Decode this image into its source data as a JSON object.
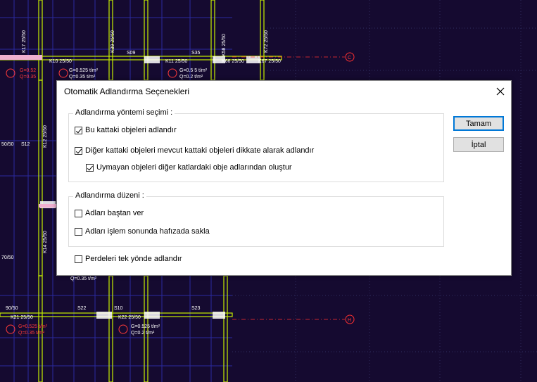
{
  "dialog": {
    "title": "Otomatik Adlandırma Seçenekleri",
    "method_group": {
      "label": "Adlandırma yöntemi seçimi :",
      "options": [
        {
          "label": "Bu kattaki objeleri adlandır",
          "checked": true
        },
        {
          "label": "Diğer kattaki objeleri mevcut kattaki objeleri dikkate alarak adlandır",
          "checked": true
        },
        {
          "label": "Uymayan objeleri diğer katlardaki obje adlarından oluştur",
          "checked": true
        }
      ]
    },
    "order_group": {
      "label": "Adlandırma düzeni :",
      "options": [
        {
          "label": "Adları baştan ver",
          "checked": false
        },
        {
          "label": "Adları işlem sonunda hafızada sakla",
          "checked": false
        }
      ]
    },
    "wall_option": {
      "label": "Perdeleri tek yönde adlandır",
      "checked": false
    },
    "buttons": {
      "ok": "Tamam",
      "cancel": "İptal"
    }
  },
  "drawing": {
    "labels": {
      "k10": "K10 25/50",
      "k11": "K11 25/50",
      "k66": "K66 25/50",
      "k67": "K67 25/50",
      "k21": "K21 25/50",
      "k22": "K22 25/50",
      "k17": "K17 25/50",
      "k39": "K39 25/50",
      "k72": "K72 25/50",
      "k58": "K58 25/50",
      "k12": "K12 25/50",
      "k14": "K14 25/50",
      "s09": "S09",
      "s10": "S10",
      "s12": "S12",
      "s22": "S22",
      "s23": "S23",
      "s35": "S35",
      "load1": "G=0.525 t/m²",
      "load2": "Q=0.35 t/m²",
      "load3": "G=0.5 5 t/m²",
      "load4": "Q=0.2 t/m²",
      "load5": "G=0.52",
      "load6": "Q=0.35",
      "load7": "Q=0.35 t/m²",
      "load8": "G=0.525 t/m²",
      "load9": "Q=0.35 t/m²",
      "load10": "G=0.525 t/m²",
      "load11": "Q=0.2 t/m²",
      "d1": "50/50",
      "d2": "90/50",
      "d3": "70/50",
      "axis_c": "C",
      "axis_h": "H"
    },
    "colors": {
      "background": "#150a30",
      "beam": "#c8f000",
      "grid": "#2a2aa0",
      "axis": "#ff2020"
    }
  }
}
